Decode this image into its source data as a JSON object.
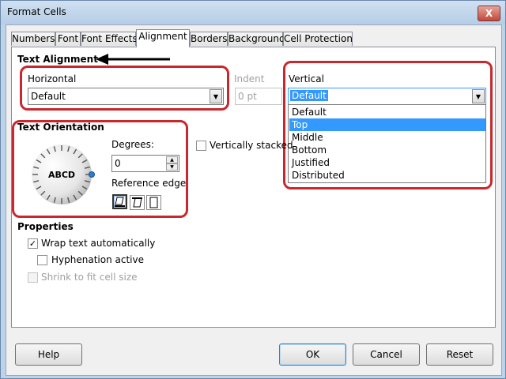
{
  "window": {
    "title": "Format Cells",
    "close_glyph": "X"
  },
  "tabs": [
    {
      "label": "Numbers"
    },
    {
      "label": "Font"
    },
    {
      "label": "Font Effects"
    },
    {
      "label": "Alignment"
    },
    {
      "label": "Borders"
    },
    {
      "label": "Background"
    },
    {
      "label": "Cell Protection"
    }
  ],
  "active_tab": "Alignment",
  "alignment": {
    "section_title": "Text Alignment",
    "horizontal_label": "Horizontal",
    "horizontal_value": "Default",
    "indent_label": "Indent",
    "indent_value": "0 pt",
    "vertical_label": "Vertical",
    "vertical_value": "Default",
    "vertical_options": [
      "Default",
      "Top",
      "Middle",
      "Bottom",
      "Justified",
      "Distributed"
    ],
    "vertical_highlighted": "Top"
  },
  "orientation": {
    "section_title": "Text Orientation",
    "dial_text": "ABCD",
    "degrees_label": "Degrees:",
    "degrees_value": "0",
    "reference_edge_label": "Reference edge:",
    "vertically_stacked_label": "Vertically stacked",
    "vertically_stacked_checked": false
  },
  "properties": {
    "section_title": "Properties",
    "wrap_text_label": "Wrap text automatically",
    "wrap_text_checked": true,
    "hyphenation_label": "Hyphenation active",
    "hyphenation_checked": false,
    "shrink_label": "Shrink to fit cell size",
    "shrink_checked": false,
    "shrink_enabled": false
  },
  "buttons": {
    "help": "Help",
    "ok": "OK",
    "cancel": "Cancel",
    "reset": "Reset"
  },
  "annotation": {
    "color": "#c8282d"
  },
  "colors": {
    "selection": "#3399ff",
    "titlebar": "#bcd3ea"
  }
}
